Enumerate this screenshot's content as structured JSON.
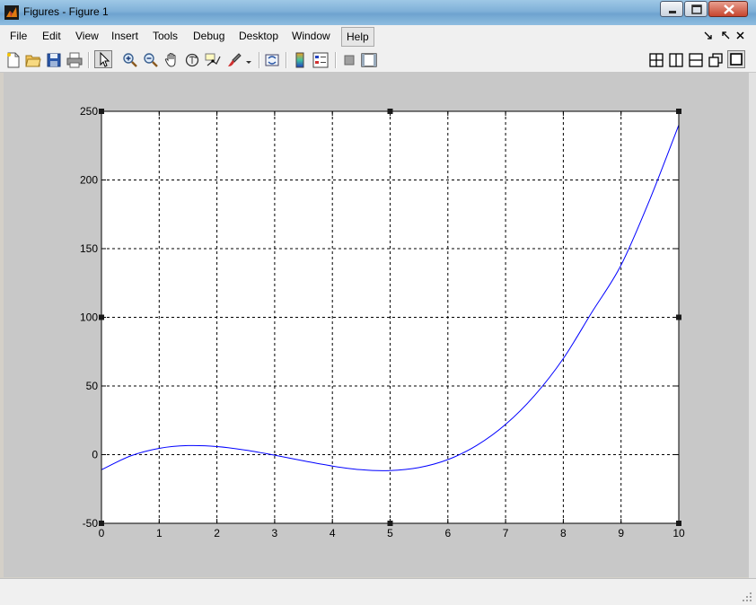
{
  "window": {
    "title": "Figures - Figure 1",
    "controls": [
      "minimize",
      "maximize",
      "close"
    ]
  },
  "menubar": {
    "items": [
      {
        "label": "File"
      },
      {
        "label": "Edit"
      },
      {
        "label": "View"
      },
      {
        "label": "Insert"
      },
      {
        "label": "Tools"
      },
      {
        "label": "Debug"
      },
      {
        "label": "Desktop"
      },
      {
        "label": "Window"
      },
      {
        "label": "Help",
        "active": true
      }
    ],
    "right_controls": [
      "undock",
      "restore",
      "close"
    ]
  },
  "toolbar": {
    "buttons": [
      "new-figure",
      "open-file",
      "save",
      "print",
      "edit-plot-arrow",
      "zoom-in",
      "zoom-out",
      "pan",
      "rotate-3d",
      "data-cursor",
      "brush",
      "brush-dropdown",
      "link-plot",
      "insert-colorbar",
      "insert-legend",
      "hide-plot-tools",
      "show-plot-tools"
    ],
    "layout_buttons": [
      "tile",
      "left-right",
      "top-bottom",
      "float",
      "maximize"
    ]
  },
  "colors": {
    "line": "#0000ff",
    "grid": "#000000",
    "canvas": "#c8c8c8",
    "axes_bg": "#ffffff"
  },
  "chart_data": {
    "type": "line",
    "title": "",
    "xlabel": "",
    "ylabel": "",
    "xlim": [
      0,
      10
    ],
    "ylim": [
      -50,
      250
    ],
    "xticks": [
      0,
      1,
      2,
      3,
      4,
      5,
      6,
      7,
      8,
      9,
      10
    ],
    "yticks": [
      -50,
      0,
      50,
      100,
      150,
      200,
      250
    ],
    "grid": true,
    "series": [
      {
        "color": "#0000ff",
        "x": [
          0,
          0.5,
          1,
          1.5,
          2,
          2.5,
          3,
          3.5,
          4,
          4.5,
          5,
          5.5,
          6,
          6.5,
          7,
          7.5,
          8,
          8.5,
          9,
          9.5,
          10
        ],
        "y": [
          -11,
          -1,
          4.6,
          6.6,
          5.9,
          3.3,
          -0.4,
          -4.5,
          -8.3,
          -11,
          -11.6,
          -9.4,
          -3.6,
          6.7,
          22,
          43,
          70,
          104,
          138,
          186,
          240
        ]
      }
    ]
  }
}
